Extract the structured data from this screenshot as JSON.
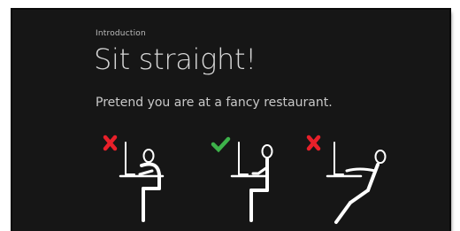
{
  "slide": {
    "section": "Introduction",
    "title": "Sit straight!",
    "subtitle": "Pretend you are at a fancy restaurant."
  },
  "icons": [
    {
      "name": "hunched-forward-posture",
      "status": "wrong",
      "status_icon": "red-cross-icon",
      "status_color": "#e8202a"
    },
    {
      "name": "upright-posture",
      "status": "correct",
      "status_icon": "green-check-icon",
      "status_color": "#3db24a"
    },
    {
      "name": "reclined-posture",
      "status": "wrong",
      "status_icon": "red-cross-icon",
      "status_color": "#e8202a"
    }
  ],
  "colors": {
    "background": "#161616",
    "text": "#d6d6d6",
    "figure_stroke": "#ffffff"
  }
}
